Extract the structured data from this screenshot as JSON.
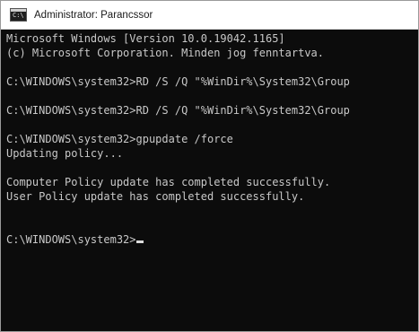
{
  "window": {
    "title": "Administrator: Parancssor",
    "icon": "cmd-icon",
    "icon_glyph": "C:\\"
  },
  "console": {
    "lines": [
      "Microsoft Windows [Version 10.0.19042.1165]",
      "(c) Microsoft Corporation. Minden jog fenntartva.",
      "",
      "C:\\WINDOWS\\system32>RD /S /Q \"%WinDir%\\System32\\Group",
      "",
      "C:\\WINDOWS\\system32>RD /S /Q \"%WinDir%\\System32\\Group",
      "",
      "C:\\WINDOWS\\system32>gpupdate /force",
      "Updating policy...",
      "",
      "Computer Policy update has completed successfully.",
      "User Policy update has completed successfully.",
      "",
      "",
      "C:\\WINDOWS\\system32>"
    ]
  },
  "colors": {
    "console_background": "#0c0c0c",
    "console_text": "#c8c8c8",
    "titlebar_background": "#ffffff"
  }
}
